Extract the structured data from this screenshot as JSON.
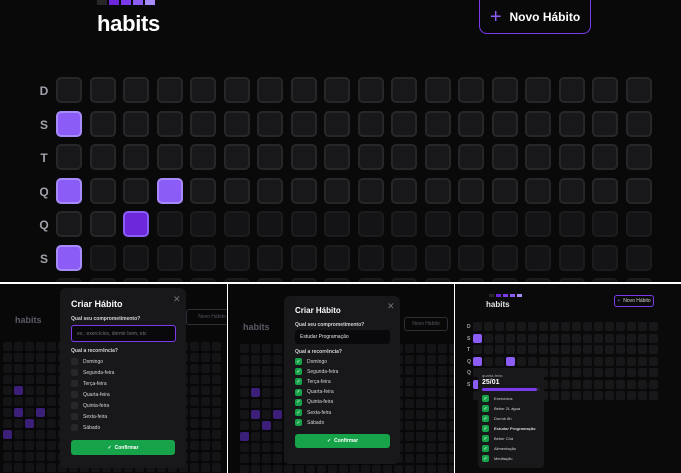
{
  "app": {
    "logo_text": "habits",
    "logo_colors": [
      "#27272a",
      "#6d28d9",
      "#7c3aed",
      "#8b5cf6",
      "#a78bfa"
    ],
    "new_habit_label": "Novo Hábito",
    "plus_icon": "plus-icon",
    "accent": "#8b5cf6"
  },
  "weekdays": [
    "D",
    "S",
    "T",
    "Q",
    "Q",
    "S"
  ],
  "modal_create": {
    "title": "Criar Hábito",
    "commitment_label": "Qual seu comprometimento?",
    "commitment_placeholder": "ex.: exercícios, dormir bem, etc",
    "recurrence_label": "Qual a recorrência?",
    "days": [
      "Domingo",
      "Segunda-feira",
      "Terça-feira",
      "Quarta-feira",
      "Quinta-feira",
      "Sexta-feira",
      "Sábado"
    ],
    "confirm_label": "Confirmar"
  },
  "modal_filled": {
    "title": "Criar Hábito",
    "commitment_label": "Qual seu comprometimento?",
    "commitment_value": "Estudar Programação",
    "recurrence_label": "Qual a recorrência?",
    "days": [
      "Domingo",
      "Segunda-feira",
      "Terça-feira",
      "Quarta-feira",
      "Quinta-feira",
      "Sexta-feira",
      "Sábado"
    ],
    "confirm_label": "Confirmar"
  },
  "mini_bg": {
    "new_habit_label": "Novo Hábito"
  },
  "popover": {
    "weekday": "quarta-feira",
    "date": "25/01",
    "progress": 0.95,
    "habits": [
      "Exercícios",
      "Beber 2L água",
      "Dormir 8h",
      "Estudar Programação",
      "Beber Chá",
      "Alimentação",
      "Meditação"
    ]
  }
}
